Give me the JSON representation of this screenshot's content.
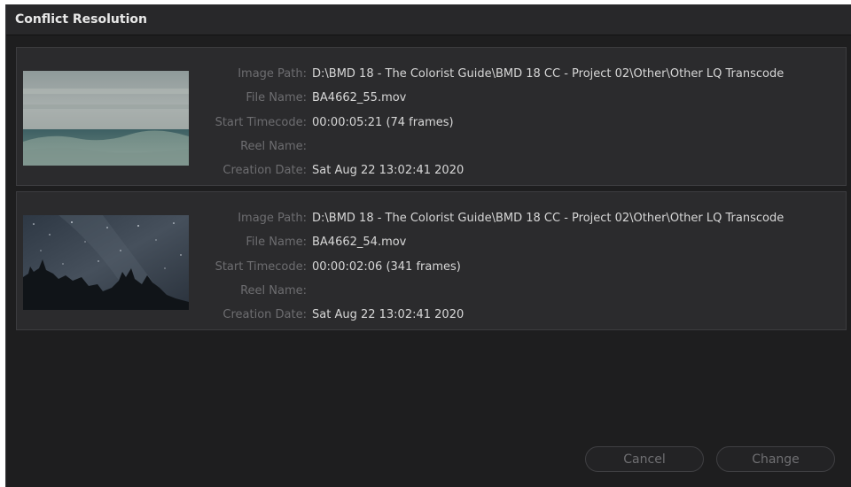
{
  "dialog": {
    "title": "Conflict Resolution"
  },
  "labels": {
    "image_path": "Image Path:",
    "file_name": "File Name:",
    "start_timecode": "Start Timecode:",
    "reel_name": "Reel Name:",
    "creation_date": "Creation Date:"
  },
  "clips": [
    {
      "image_path": "D:\\BMD 18 - The Colorist Guide\\BMD 18 CC - Project 02\\Other\\Other LQ Transcode",
      "file_name": "BA4662_55.mov",
      "start_timecode": "00:00:05:21 (74 frames)",
      "reel_name": "",
      "creation_date": "Sat Aug 22 13:02:41 2020"
    },
    {
      "image_path": "D:\\BMD 18 - The Colorist Guide\\BMD 18 CC - Project 02\\Other\\Other LQ Transcode",
      "file_name": "BA4662_54.mov",
      "start_timecode": "00:00:02:06 (341 frames)",
      "reel_name": "",
      "creation_date": "Sat Aug 22 13:02:41 2020"
    }
  ],
  "buttons": {
    "cancel": "Cancel",
    "change": "Change"
  }
}
